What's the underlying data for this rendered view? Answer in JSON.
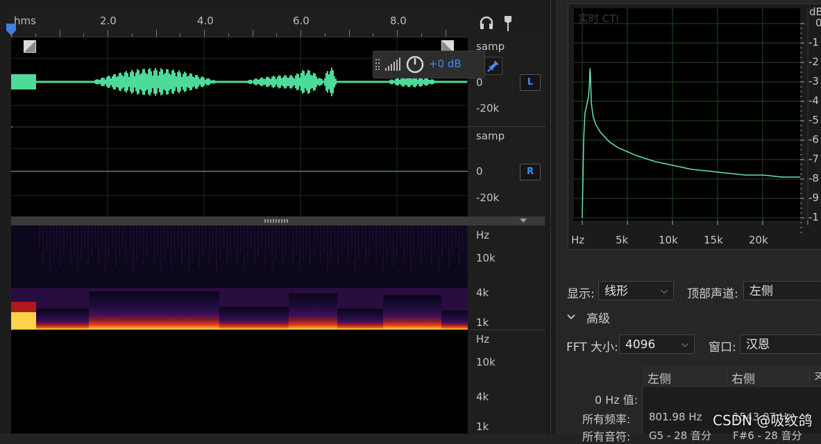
{
  "ruler": {
    "unit": "hms",
    "labels": [
      "2.0",
      "4.0",
      "6.0",
      "8.0"
    ]
  },
  "channels": {
    "left": {
      "scale_top": "samp",
      "scale_zero": "0",
      "scale_bottom": "-20k",
      "button": "L"
    },
    "right": {
      "scale_top": "samp",
      "scale_zero": "0",
      "scale_bottom": "-20k",
      "button": "R"
    }
  },
  "hud": {
    "gain": "+0 dB"
  },
  "spectral": {
    "left": {
      "unit": "Hz",
      "ticks": [
        "10k",
        "4k",
        "1k"
      ]
    },
    "right": {
      "unit": "Hz",
      "ticks": [
        "10k",
        "4k",
        "1k"
      ]
    }
  },
  "analysis": {
    "graph_title": "实时 CTI",
    "db_unit": "dB",
    "db_ticks": [
      "0",
      "-1",
      "-2",
      "-3",
      "-4",
      "-5",
      "-6",
      "-7",
      "-8",
      "-9",
      "-1"
    ],
    "freq_unit": "Hz",
    "freq_ticks": [
      "5k",
      "10k",
      "15k",
      "20k"
    ],
    "display_label": "显示:",
    "display_value": "线形",
    "top_channel_label": "顶部声道:",
    "top_channel_value": "左侧",
    "advanced_label": "高级",
    "fft_label": "FFT 大小:",
    "fft_value": "4096",
    "window_label": "窗口:",
    "window_value": "汉恩",
    "table": {
      "col_left": "左侧",
      "col_right": "右侧",
      "col_third": "ヌ",
      "row1_label": "0 Hz 值:",
      "row2_label": "所有频率:",
      "row2_left": "801.98 Hz",
      "row2_right": "1543.07 Hz",
      "row3_label": "所有音符:",
      "row3_left": "G5 - 28 音分",
      "row3_right": "F#6 - 28 音分"
    },
    "watermark": "CSDN @吸纹鸽"
  },
  "colors": {
    "waveform": "#4ddb9a",
    "accent": "#3f8cf0",
    "spectrum_line": "#6fe3b4",
    "grid": "#1f4a1f"
  },
  "chart_data": {
    "type": "line",
    "title": "实时 CTI",
    "xlabel": "Hz",
    "ylabel": "dB",
    "xlim": [
      0,
      24000
    ],
    "x_ticks": [
      "5k",
      "10k",
      "15k",
      "20k"
    ],
    "grid": true,
    "series": [
      {
        "x": [
          0,
          150,
          300,
          500,
          700,
          800,
          850,
          900,
          1000,
          1200,
          1500,
          2000,
          3000,
          4000,
          6000,
          8000,
          10000,
          12000,
          14000,
          16000,
          18000,
          20000,
          22000,
          24000
        ],
        "values": [
          -100,
          -60,
          -46,
          -42,
          -37,
          -30,
          -23,
          -26,
          -41,
          -48,
          -52,
          -56,
          -61,
          -64,
          -68,
          -71,
          -73,
          -75,
          -76,
          -77,
          -78,
          -78,
          -79,
          -79
        ]
      }
    ]
  }
}
